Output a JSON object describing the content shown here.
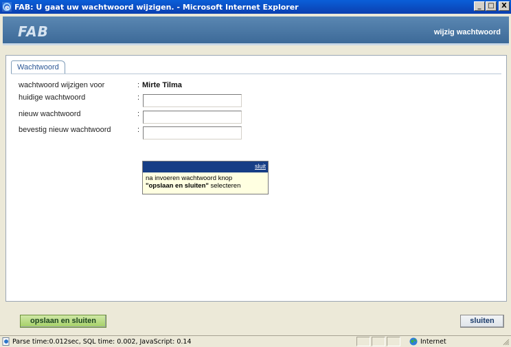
{
  "window": {
    "title": "FAB: U gaat uw wachtwoord wijzigen. - Microsoft Internet Explorer",
    "minimize_label": "_",
    "maximize_label": "□",
    "close_label": "X"
  },
  "header": {
    "brand": "FAB",
    "right_label": "wijzig wachtwoord"
  },
  "tab": {
    "label": "Wachtwoord"
  },
  "form": {
    "rows": [
      {
        "label": "wachtwoord wijzigen voor",
        "colon": ":",
        "value": "Mirte Tilma"
      },
      {
        "label": "huidige wachtwoord",
        "colon": ":",
        "value": ""
      },
      {
        "label": "nieuw wachtwoord",
        "colon": ":",
        "value": ""
      },
      {
        "label": "bevestig nieuw wachtwoord",
        "colon": ":",
        "value": ""
      }
    ]
  },
  "popup": {
    "close_link": "sluit",
    "line1": "na invoeren wachtwoord knop",
    "line2_bold": "\"opslaan en sluiten\"",
    "line2_rest": " selecteren"
  },
  "buttons": {
    "save": "opslaan en sluiten",
    "close": "sluiten"
  },
  "statusbar": {
    "text": "Parse time:0.012sec, SQL time: 0.002, JavaScript: 0.14",
    "zone": "Internet"
  },
  "colors": {
    "titlebar": "#0a5fd8",
    "header": "#4a77a5",
    "popup_header": "#173e86",
    "save_button": "#a4cf66"
  }
}
